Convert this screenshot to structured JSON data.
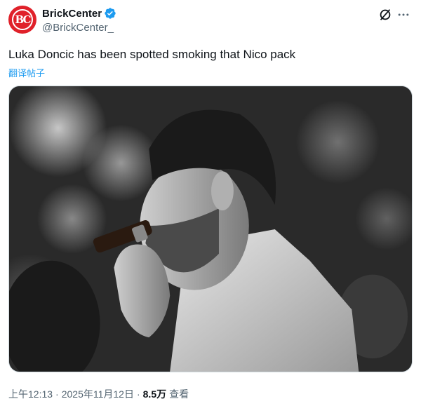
{
  "author": {
    "display_name": "BrickCenter",
    "handle": "@BrickCenter_",
    "avatar_text": "BC",
    "verified": true
  },
  "tweet": {
    "text": "Luka Doncic has been spotted smoking that Nico pack",
    "translate_label": "翻译帖子"
  },
  "meta": {
    "time": "上午12:13",
    "separator": "·",
    "date": "2025年11月12日",
    "views_count": "8.5万",
    "views_label": "查看"
  },
  "icons": {
    "verified": "verified-badge-icon",
    "grok": "grok-icon",
    "more": "more-options-icon"
  },
  "colors": {
    "avatar_bg": "#e0212a",
    "verified_blue": "#1d9bf0",
    "link_blue": "#1d9bf0",
    "secondary_text": "#536471",
    "primary_text": "#0f1419"
  }
}
